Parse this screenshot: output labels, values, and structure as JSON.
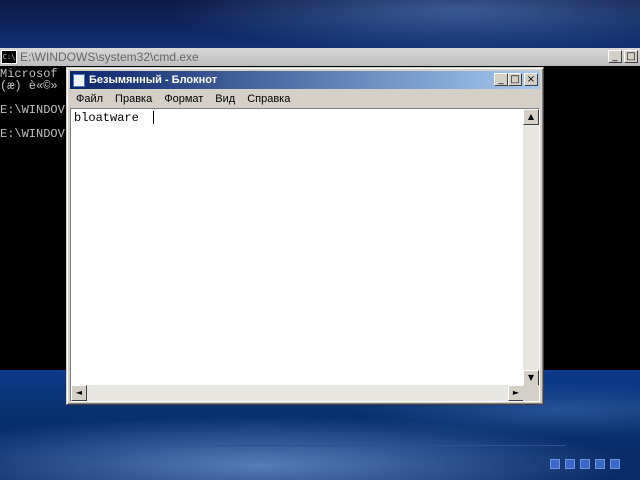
{
  "cmd_window": {
    "title": "E:\\WINDOWS\\system32\\cmd.exe",
    "icon_text": "C:\\",
    "lines": [
      "Microsof",
      "(æ) è«©»",
      "",
      "E:\\WINDOV",
      "",
      "E:\\WINDOV"
    ],
    "buttons": {
      "minimize": "_",
      "maximize": "□"
    }
  },
  "notepad": {
    "title": "Безымянный - Блокнот",
    "menu": [
      "Файл",
      "Правка",
      "Формат",
      "Вид",
      "Справка"
    ],
    "text": "bloatware ",
    "buttons": {
      "minimize": "_",
      "maximize": "□",
      "close": "×"
    },
    "scroll_arrows": {
      "up": "▲",
      "down": "▼",
      "left": "◄",
      "right": "►"
    }
  },
  "colors": {
    "titlebar_active_start": "#0a246a",
    "titlebar_active_end": "#a6caf0",
    "window_face": "#d4d0c8",
    "console_bg": "#000000",
    "console_fg": "#c0c0c0",
    "boot_dot": "#3c66c8"
  }
}
